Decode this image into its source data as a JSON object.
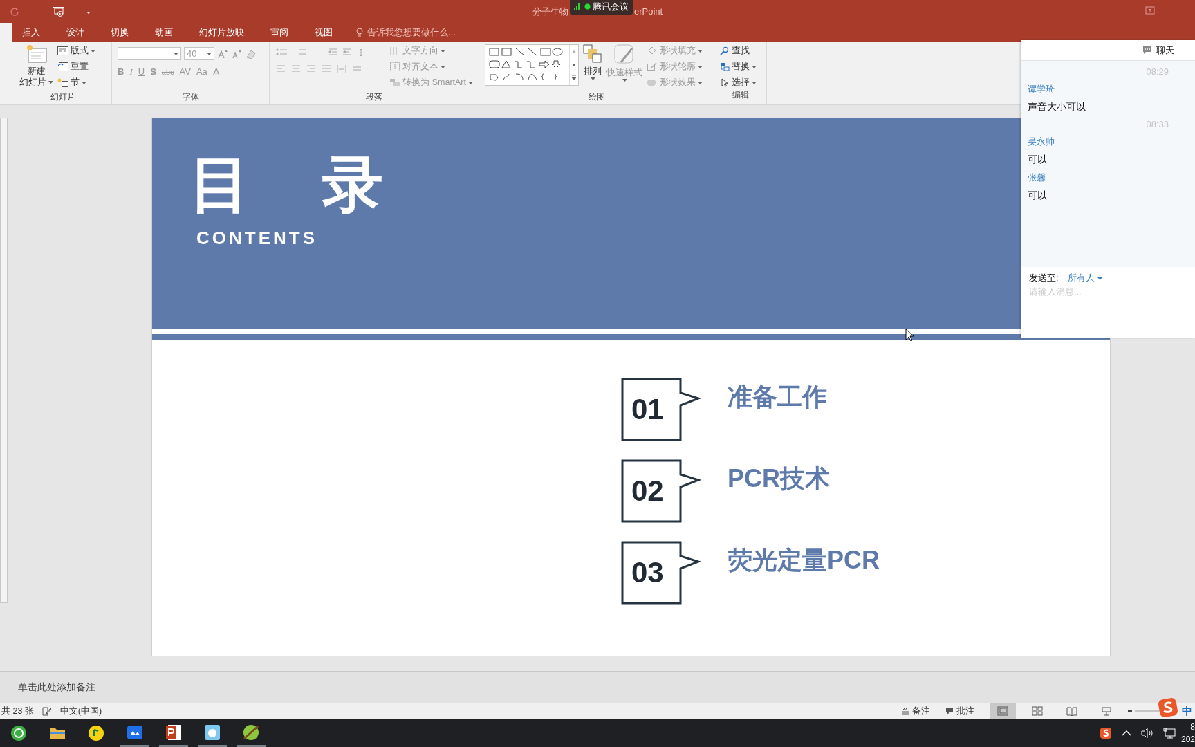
{
  "window": {
    "title_start": "分子生物",
    "title_end": "erPoint"
  },
  "meeting_badge": {
    "label": "腾讯会议"
  },
  "tabs": [
    {
      "label": "插入",
      "selected": false
    },
    {
      "label": "设计",
      "selected": false
    },
    {
      "label": "切换",
      "selected": false
    },
    {
      "label": "动画",
      "selected": false
    },
    {
      "label": "幻灯片放映",
      "selected": false
    },
    {
      "label": "审阅",
      "selected": false
    },
    {
      "label": "视图",
      "selected": false
    }
  ],
  "tell_me": {
    "placeholder": "告诉我您想要做什么..."
  },
  "slides_group": {
    "new_slide_top": "新建",
    "new_slide_bottom": "幻灯片",
    "layout": "版式",
    "reset": "重置",
    "section": "节",
    "label": "幻灯片"
  },
  "font_group": {
    "size": "40",
    "format_buttons": [
      "B",
      "I",
      "U",
      "S",
      "abc",
      "AV",
      "Aa",
      "A"
    ],
    "label": "字体"
  },
  "paragraph_group": {
    "text_direction": "文字方向",
    "align_text": "对齐文本",
    "smartart": "转换为 SmartArt",
    "label": "段落"
  },
  "drawing_group": {
    "arrange": "排列",
    "quick_styles": "快速样式",
    "fill": "形状填充",
    "outline": "形状轮廓",
    "effects": "形状效果",
    "label": "绘图"
  },
  "editing_group": {
    "find": "查找",
    "replace": "替换",
    "select": "选择",
    "label": "编辑"
  },
  "slide": {
    "title": "目　录",
    "subtitle": "CONTENTS",
    "items": [
      {
        "number": "01",
        "label": "准备工作"
      },
      {
        "number": "02",
        "label": "PCR技术"
      },
      {
        "number": "03",
        "label": "荧光定量PCR"
      }
    ]
  },
  "chat": {
    "title": "聊天",
    "entries": [
      {
        "kind": "time",
        "text": "08:29"
      },
      {
        "kind": "sender",
        "text": "谭学琦"
      },
      {
        "kind": "message",
        "text": "声音大小可以"
      },
      {
        "kind": "time",
        "text": "08:33"
      },
      {
        "kind": "sender",
        "text": "吴永帅"
      },
      {
        "kind": "message",
        "text": "可以"
      },
      {
        "kind": "sender",
        "text": "张馨"
      },
      {
        "kind": "message",
        "text": "可以"
      }
    ],
    "send_to_label": "发送至:",
    "recipient": "所有人",
    "placeholder": "请输入消息..."
  },
  "notes": {
    "placeholder": "单击此处添加备注"
  },
  "status_bar": {
    "slide_count": "共 23 张",
    "language": "中文(中国)",
    "notes": "备注",
    "comments": "批注",
    "views": [
      {
        "kind": "normal",
        "selected": true
      },
      {
        "kind": "sorter",
        "selected": false
      },
      {
        "kind": "reading",
        "selected": false
      },
      {
        "kind": "show",
        "selected": false
      }
    ],
    "ime": "中"
  },
  "taskbar": {
    "apps": [
      {
        "kind": "browser",
        "running": false
      },
      {
        "kind": "folder",
        "running": false
      },
      {
        "kind": "music",
        "running": false
      },
      {
        "kind": "meeting",
        "running": true
      },
      {
        "kind": "powerpoint",
        "running": true
      },
      {
        "kind": "game",
        "running": true
      },
      {
        "kind": "ball",
        "running": true
      }
    ],
    "clock_time": "8",
    "clock_date": "202"
  }
}
